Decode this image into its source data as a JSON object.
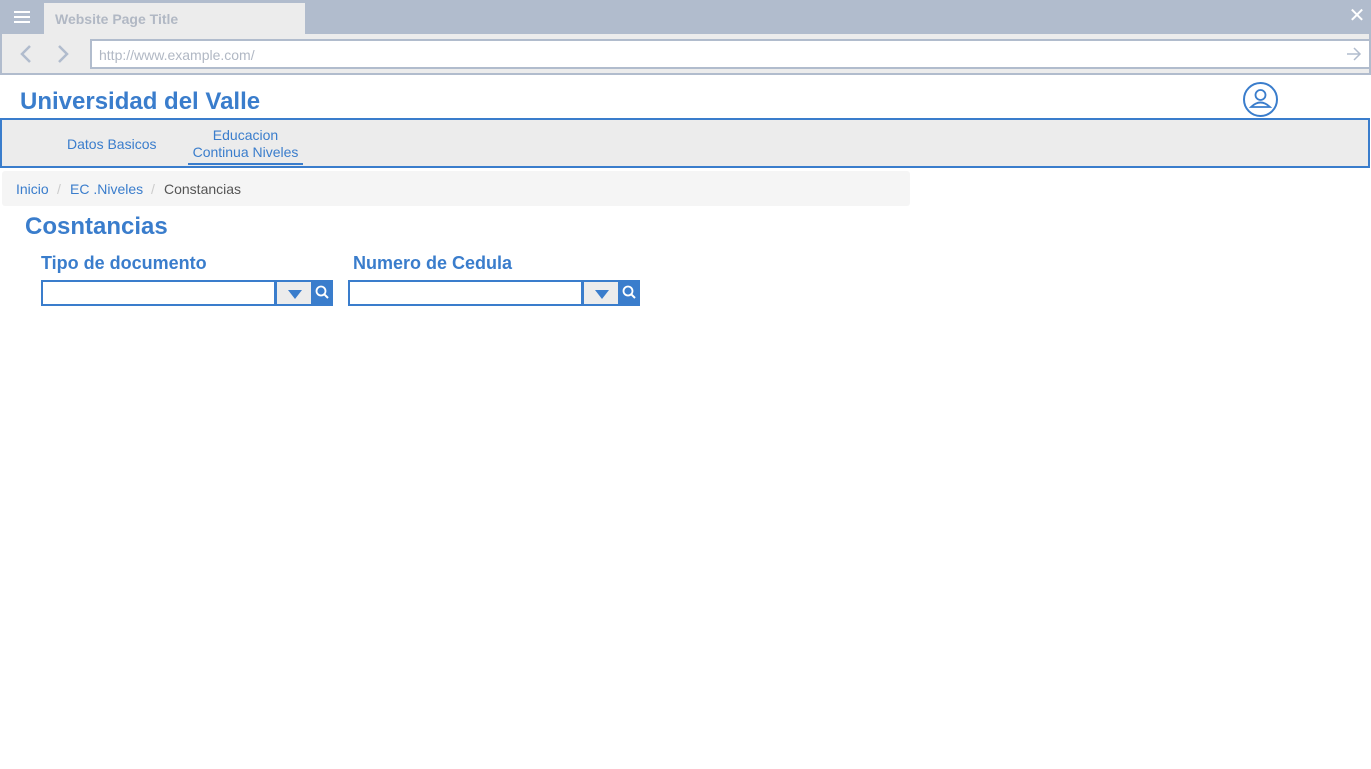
{
  "browser": {
    "tab_title": "Website Page Title",
    "url": "http://www.example.com/"
  },
  "header": {
    "site_title": "Universidad del Valle"
  },
  "nav": {
    "items": [
      {
        "label": "Datos Basicos"
      },
      {
        "label_line1": "Educacion",
        "label_line2": "Continua Niveles"
      }
    ]
  },
  "breadcrumb": {
    "items": [
      {
        "label": "Inicio"
      },
      {
        "label": "EC .Niveles"
      },
      {
        "label": "Constancias"
      }
    ],
    "separator": "/"
  },
  "page": {
    "title": "Cosntancias"
  },
  "form": {
    "tipo_label": "Tipo de documento",
    "tipo_value": "",
    "cedula_label": "Numero de Cedula",
    "cedula_value": ""
  },
  "colors": {
    "accent": "#3a7dcc",
    "chrome": "#b1bccd",
    "panel": "#ececec"
  },
  "icons": [
    "menu-icon",
    "close-icon",
    "back-arrow-icon",
    "forward-arrow-icon",
    "go-arrow-icon",
    "user-icon",
    "dropdown-icon",
    "search-icon"
  ]
}
